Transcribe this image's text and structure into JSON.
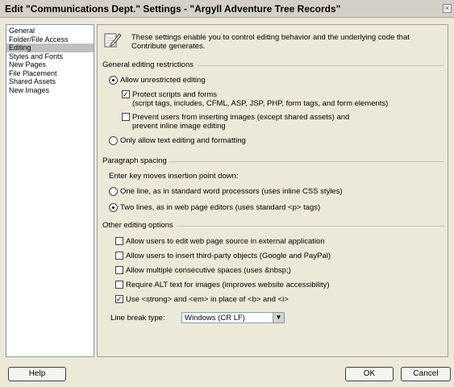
{
  "window": {
    "title": "Edit \"Communications Dept.\" Settings - \"Argyll Adventure Tree Records\"",
    "close_glyph": "×"
  },
  "sidebar": {
    "items": [
      {
        "label": "General"
      },
      {
        "label": "Folder/File Access"
      },
      {
        "label": "Editing"
      },
      {
        "label": "Styles and Fonts"
      },
      {
        "label": "New Pages"
      },
      {
        "label": "File Placement"
      },
      {
        "label": "Shared Assets"
      },
      {
        "label": "New Images"
      }
    ],
    "selected_index": 2
  },
  "intro": {
    "icon": "pencil-paper-icon",
    "text_line1": "These settings enable you to control editing behavior and the underlying code that",
    "text_line2": "Contribute generates."
  },
  "general_restrictions": {
    "heading": "General editing restrictions",
    "allow_unrestricted": {
      "label": "Allow unrestricted editing",
      "checked": true
    },
    "protect_scripts": {
      "label_line1": "Protect scripts and forms",
      "label_line2": "(script tags, includes, CFML, ASP, JSP, PHP, form tags, and form elements)",
      "checked": true
    },
    "prevent_images": {
      "label_line1": "Prevent users from inserting images (except shared assets) and",
      "label_line2": "prevent inline image editing",
      "checked": false
    },
    "only_text": {
      "label": "Only allow text editing and formatting",
      "checked": false
    }
  },
  "paragraph_spacing": {
    "heading": "Paragraph spacing",
    "prompt": "Enter key moves insertion point down:",
    "one_line": {
      "label": "One line, as in standard word processors (uses inline CSS styles)",
      "checked": false
    },
    "two_lines": {
      "label": "Two lines, as in web page editors (uses standard <p> tags)",
      "checked": true
    }
  },
  "other_options": {
    "heading": "Other editing options",
    "options": [
      {
        "label": "Allow users to edit web page source in external application",
        "checked": false
      },
      {
        "label": "Allow users to insert third-party objects (Google and PayPal)",
        "checked": false
      },
      {
        "label": "Allow multiple consecutive spaces (uses &nbsp;)",
        "checked": false
      },
      {
        "label": "Require ALT text for images (improves website accessibility)",
        "checked": false
      },
      {
        "label": "Use <strong> and <em> in place of <b> and <i>",
        "checked": true
      }
    ],
    "line_break_label": "Line break type:",
    "line_break_value": "Windows (CR LF)",
    "dropdown_glyph": "▼"
  },
  "buttons": {
    "help": "Help",
    "ok": "OK",
    "cancel": "Cancel"
  }
}
